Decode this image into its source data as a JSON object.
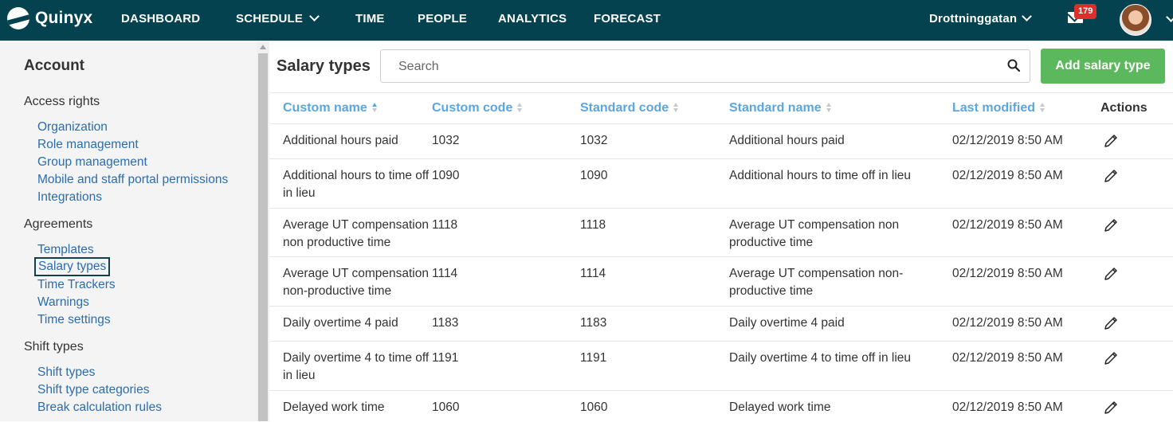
{
  "app": {
    "logo_text": "Quinyx",
    "nav": [
      {
        "label": "DASHBOARD"
      },
      {
        "label": "SCHEDULE"
      },
      {
        "label": "TIME"
      },
      {
        "label": "PEOPLE"
      },
      {
        "label": "ANALYTICS"
      },
      {
        "label": "FORECAST"
      }
    ],
    "unit_selector": "Drottninggatan",
    "notification_count": "179"
  },
  "sidebar": {
    "title": "Account",
    "groups": [
      {
        "label": "Access rights",
        "items": [
          "Organization",
          "Role management",
          "Group management",
          "Mobile and staff portal permissions",
          "Integrations"
        ]
      },
      {
        "label": "Agreements",
        "items": [
          "Templates",
          "Salary types",
          "Time Trackers",
          "Warnings",
          "Time settings"
        ]
      },
      {
        "label": "Shift types",
        "items": [
          "Shift types",
          "Shift type categories",
          "Break calculation rules"
        ]
      }
    ]
  },
  "main": {
    "title": "Salary types",
    "search": {
      "placeholder": "Search",
      "value": ""
    },
    "add_button": "Add salary type",
    "columns": [
      "Custom name",
      "Custom code",
      "Standard code",
      "Standard name",
      "Last modified",
      "Actions"
    ],
    "sort": {
      "column": "Custom name",
      "direction": "ascending"
    },
    "rows": [
      {
        "custom_name": "Additional hours paid",
        "custom_code": "1032",
        "standard_code": "1032",
        "standard_name": "Additional hours paid",
        "last_modified": "02/12/2019 8:50 AM"
      },
      {
        "custom_name": "Additional hours to time off in lieu",
        "custom_code": "1090",
        "standard_code": "1090",
        "standard_name": "Additional hours to time off in lieu",
        "last_modified": "02/12/2019 8:50 AM"
      },
      {
        "custom_name": "Average UT compensation non productive time",
        "custom_code": "1118",
        "standard_code": "1118",
        "standard_name": "Average UT compensation non productive time",
        "last_modified": "02/12/2019 8:50 AM"
      },
      {
        "custom_name": "Average UT compensation non-productive time",
        "custom_code": "1114",
        "standard_code": "1114",
        "standard_name": "Average UT compensation non-productive time",
        "last_modified": "02/12/2019 8:50 AM"
      },
      {
        "custom_name": "Daily overtime 4 paid",
        "custom_code": "1183",
        "standard_code": "1183",
        "standard_name": "Daily overtime 4 paid",
        "last_modified": "02/12/2019 8:50 AM"
      },
      {
        "custom_name": "Daily overtime 4 to time off in lieu",
        "custom_code": "1191",
        "standard_code": "1191",
        "standard_name": "Daily overtime 4 to time off in lieu",
        "last_modified": "02/12/2019 8:50 AM"
      },
      {
        "custom_name": "Delayed work time",
        "custom_code": "1060",
        "standard_code": "1060",
        "standard_name": "Delayed work time",
        "last_modified": "02/12/2019 8:50 AM"
      }
    ]
  },
  "colors": {
    "topbar": "#04424f",
    "link": "#2a6db0",
    "header_link": "#5aa6e0",
    "primary_button": "#5cb85c",
    "badge": "#d9302c"
  }
}
